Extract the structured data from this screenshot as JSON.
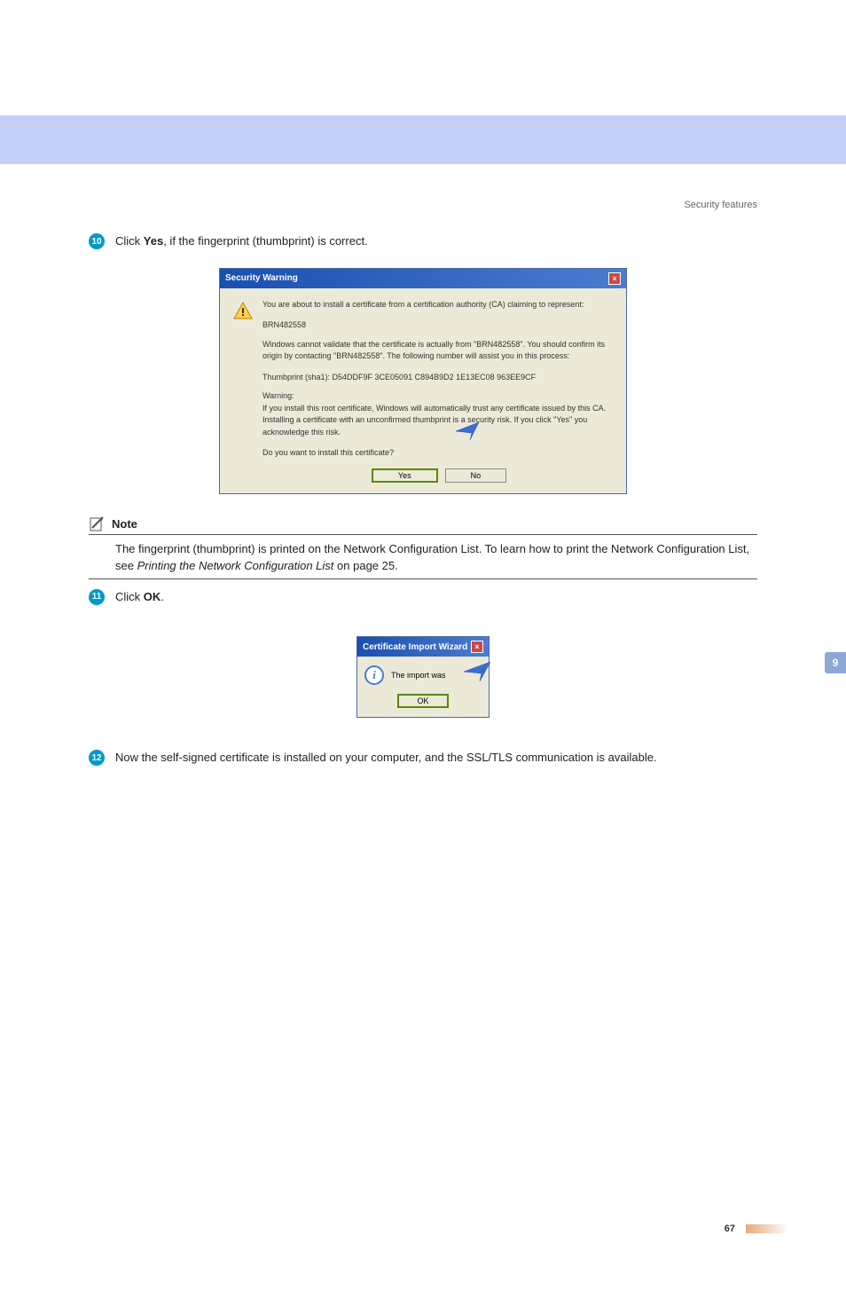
{
  "header": {
    "section": "Security features"
  },
  "steps": {
    "s10": {
      "num": "10",
      "text_pre": "Click ",
      "bold": "Yes",
      "text_post": ", if the fingerprint (thumbprint) is correct."
    },
    "s11": {
      "num": "11",
      "text_pre": "Click ",
      "bold": "OK",
      "text_post": "."
    },
    "s12": {
      "num": "12",
      "text": "Now the self-signed certificate is installed on your computer, and the SSL/TLS communication is available."
    }
  },
  "sec_dialog": {
    "title": "Security Warning",
    "p1": "You are about to install a certificate from a certification authority (CA) claiming to represent:",
    "p_name": "BRN482558",
    "p2": "Windows cannot validate that the certificate is actually from \"BRN482558\". You should confirm its origin by contacting \"BRN482558\". The following number will assist you in this process:",
    "p_thumb": "Thumbprint (sha1): D54DDF9F 3CE05091 C894B9D2 1E13EC08 963EE9CF",
    "p_warn_label": "Warning:",
    "p_warn": "If you install this root certificate, Windows will automatically trust any certificate issued by this CA. Installing a certificate with an unconfirmed thumbprint is a security risk. If you click \"Yes\" you acknowledge this risk.",
    "p_confirm": "Do you want to install this certificate?",
    "btn_yes": "Yes",
    "btn_no": "No"
  },
  "note": {
    "label": "Note",
    "body_pre": "The fingerprint (thumbprint) is printed on the Network Configuration List. To learn how to print the Network Configuration List, see ",
    "body_italic": "Printing the Network Configuration List",
    "body_post": " on page 25."
  },
  "cert_dialog": {
    "title": "Certificate Import Wizard",
    "msg": "The import was ",
    "btn_ok": "OK"
  },
  "side_tab": "9",
  "footer": {
    "page": "67"
  }
}
